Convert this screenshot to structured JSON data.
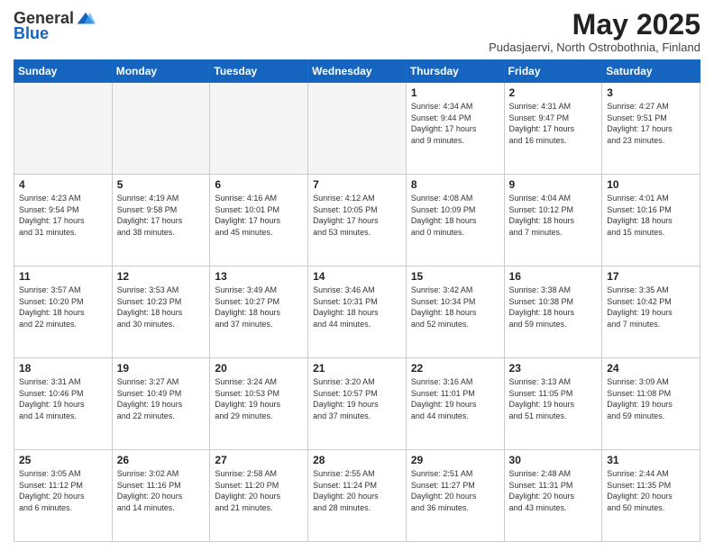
{
  "logo": {
    "general": "General",
    "blue": "Blue"
  },
  "header": {
    "title": "May 2025",
    "location": "Pudasjaervi, North Ostrobothnia, Finland"
  },
  "weekdays": [
    "Sunday",
    "Monday",
    "Tuesday",
    "Wednesday",
    "Thursday",
    "Friday",
    "Saturday"
  ],
  "weeks": [
    [
      {
        "day": "",
        "info": ""
      },
      {
        "day": "",
        "info": ""
      },
      {
        "day": "",
        "info": ""
      },
      {
        "day": "",
        "info": ""
      },
      {
        "day": "1",
        "info": "Sunrise: 4:34 AM\nSunset: 9:44 PM\nDaylight: 17 hours\nand 9 minutes."
      },
      {
        "day": "2",
        "info": "Sunrise: 4:31 AM\nSunset: 9:47 PM\nDaylight: 17 hours\nand 16 minutes."
      },
      {
        "day": "3",
        "info": "Sunrise: 4:27 AM\nSunset: 9:51 PM\nDaylight: 17 hours\nand 23 minutes."
      }
    ],
    [
      {
        "day": "4",
        "info": "Sunrise: 4:23 AM\nSunset: 9:54 PM\nDaylight: 17 hours\nand 31 minutes."
      },
      {
        "day": "5",
        "info": "Sunrise: 4:19 AM\nSunset: 9:58 PM\nDaylight: 17 hours\nand 38 minutes."
      },
      {
        "day": "6",
        "info": "Sunrise: 4:16 AM\nSunset: 10:01 PM\nDaylight: 17 hours\nand 45 minutes."
      },
      {
        "day": "7",
        "info": "Sunrise: 4:12 AM\nSunset: 10:05 PM\nDaylight: 17 hours\nand 53 minutes."
      },
      {
        "day": "8",
        "info": "Sunrise: 4:08 AM\nSunset: 10:09 PM\nDaylight: 18 hours\nand 0 minutes."
      },
      {
        "day": "9",
        "info": "Sunrise: 4:04 AM\nSunset: 10:12 PM\nDaylight: 18 hours\nand 7 minutes."
      },
      {
        "day": "10",
        "info": "Sunrise: 4:01 AM\nSunset: 10:16 PM\nDaylight: 18 hours\nand 15 minutes."
      }
    ],
    [
      {
        "day": "11",
        "info": "Sunrise: 3:57 AM\nSunset: 10:20 PM\nDaylight: 18 hours\nand 22 minutes."
      },
      {
        "day": "12",
        "info": "Sunrise: 3:53 AM\nSunset: 10:23 PM\nDaylight: 18 hours\nand 30 minutes."
      },
      {
        "day": "13",
        "info": "Sunrise: 3:49 AM\nSunset: 10:27 PM\nDaylight: 18 hours\nand 37 minutes."
      },
      {
        "day": "14",
        "info": "Sunrise: 3:46 AM\nSunset: 10:31 PM\nDaylight: 18 hours\nand 44 minutes."
      },
      {
        "day": "15",
        "info": "Sunrise: 3:42 AM\nSunset: 10:34 PM\nDaylight: 18 hours\nand 52 minutes."
      },
      {
        "day": "16",
        "info": "Sunrise: 3:38 AM\nSunset: 10:38 PM\nDaylight: 18 hours\nand 59 minutes."
      },
      {
        "day": "17",
        "info": "Sunrise: 3:35 AM\nSunset: 10:42 PM\nDaylight: 19 hours\nand 7 minutes."
      }
    ],
    [
      {
        "day": "18",
        "info": "Sunrise: 3:31 AM\nSunset: 10:46 PM\nDaylight: 19 hours\nand 14 minutes."
      },
      {
        "day": "19",
        "info": "Sunrise: 3:27 AM\nSunset: 10:49 PM\nDaylight: 19 hours\nand 22 minutes."
      },
      {
        "day": "20",
        "info": "Sunrise: 3:24 AM\nSunset: 10:53 PM\nDaylight: 19 hours\nand 29 minutes."
      },
      {
        "day": "21",
        "info": "Sunrise: 3:20 AM\nSunset: 10:57 PM\nDaylight: 19 hours\nand 37 minutes."
      },
      {
        "day": "22",
        "info": "Sunrise: 3:16 AM\nSunset: 11:01 PM\nDaylight: 19 hours\nand 44 minutes."
      },
      {
        "day": "23",
        "info": "Sunrise: 3:13 AM\nSunset: 11:05 PM\nDaylight: 19 hours\nand 51 minutes."
      },
      {
        "day": "24",
        "info": "Sunrise: 3:09 AM\nSunset: 11:08 PM\nDaylight: 19 hours\nand 59 minutes."
      }
    ],
    [
      {
        "day": "25",
        "info": "Sunrise: 3:05 AM\nSunset: 11:12 PM\nDaylight: 20 hours\nand 6 minutes."
      },
      {
        "day": "26",
        "info": "Sunrise: 3:02 AM\nSunset: 11:16 PM\nDaylight: 20 hours\nand 14 minutes."
      },
      {
        "day": "27",
        "info": "Sunrise: 2:58 AM\nSunset: 11:20 PM\nDaylight: 20 hours\nand 21 minutes."
      },
      {
        "day": "28",
        "info": "Sunrise: 2:55 AM\nSunset: 11:24 PM\nDaylight: 20 hours\nand 28 minutes."
      },
      {
        "day": "29",
        "info": "Sunrise: 2:51 AM\nSunset: 11:27 PM\nDaylight: 20 hours\nand 36 minutes."
      },
      {
        "day": "30",
        "info": "Sunrise: 2:48 AM\nSunset: 11:31 PM\nDaylight: 20 hours\nand 43 minutes."
      },
      {
        "day": "31",
        "info": "Sunrise: 2:44 AM\nSunset: 11:35 PM\nDaylight: 20 hours\nand 50 minutes."
      }
    ]
  ]
}
